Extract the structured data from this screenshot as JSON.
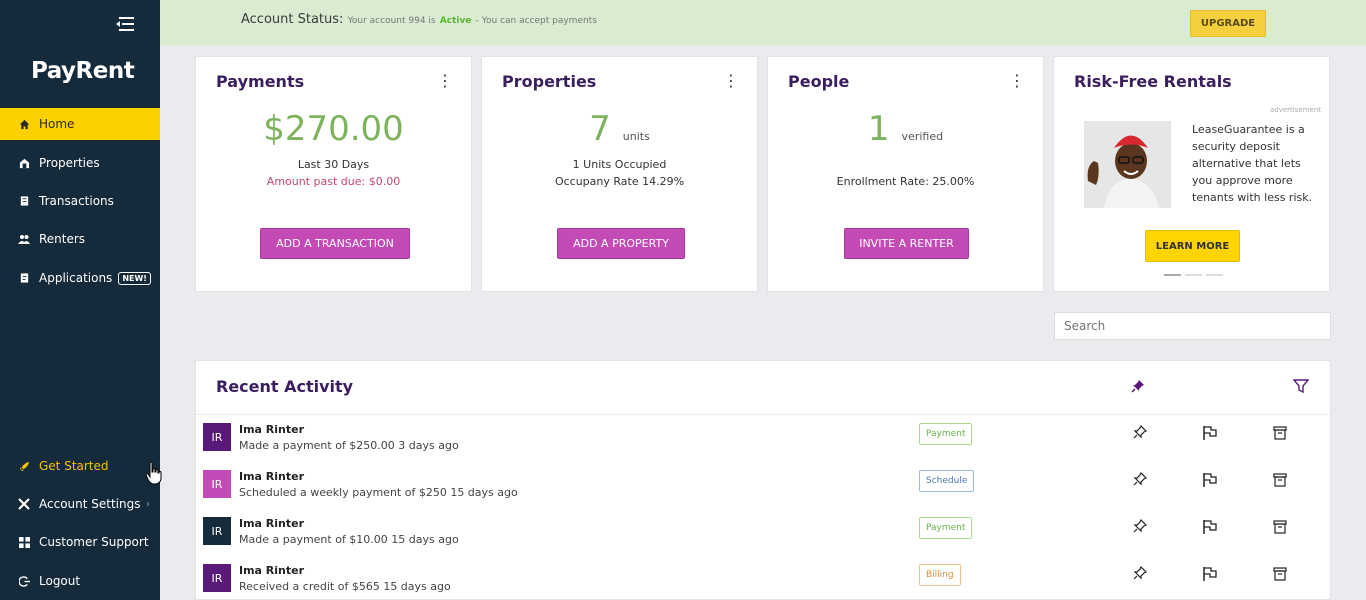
{
  "sidebar": {
    "logo": "PayRent",
    "items": [
      {
        "label": "Home",
        "icon": "home-icon",
        "active": true
      },
      {
        "label": "Properties",
        "icon": "properties-icon"
      },
      {
        "label": "Transactions",
        "icon": "transactions-icon"
      },
      {
        "label": "Renters",
        "icon": "renters-icon"
      },
      {
        "label": "Applications",
        "icon": "applications-icon",
        "badge": "NEW!"
      }
    ],
    "bottom_items": [
      {
        "label": "Get Started",
        "icon": "rocket-icon"
      },
      {
        "label": "Account Settings",
        "icon": "tools-icon"
      },
      {
        "label": "Customer Support",
        "icon": "support-icon"
      },
      {
        "label": "Logout",
        "icon": "logout-icon"
      }
    ]
  },
  "status_bar": {
    "title": "Account Status:",
    "text_prefix": "Your account 994 is",
    "status": "Active",
    "text_suffix": "- You can accept payments",
    "upgrade_label": "UPGRADE"
  },
  "cards": {
    "payments": {
      "title": "Payments",
      "amount": "$270.00",
      "period": "Last 30 Days",
      "past_due": "Amount past due: $0.00",
      "button": "ADD A TRANSACTION"
    },
    "properties": {
      "title": "Properties",
      "count": "7",
      "unit": "units",
      "occupied": "1 Units Occupied",
      "occupancy": "Occupany Rate 14.29%",
      "button": "ADD A PROPERTY"
    },
    "people": {
      "title": "People",
      "count": "1",
      "unit": "verified",
      "enrollment": "Enrollment Rate: 25.00%",
      "button": "INVITE A RENTER"
    },
    "ad": {
      "title": "Risk-Free Rentals",
      "label": "advertisement",
      "text": "LeaseGuarantee is a security deposit alternative that lets you approve more tenants with less risk.",
      "button": "LEARN MORE"
    }
  },
  "search": {
    "placeholder": "Search"
  },
  "activity": {
    "title": "Recent Activity",
    "rows": [
      {
        "initials": "IR",
        "name": "Ima Rinter",
        "desc": "Made a payment of $250.00 3 days ago",
        "tag": "Payment",
        "avatar_color": "#5a1a7a"
      },
      {
        "initials": "IR",
        "name": "Ima Rinter",
        "desc": "Scheduled a weekly payment of $250 15 days ago",
        "tag": "Schedule",
        "avatar_color": "#c44bb6"
      },
      {
        "initials": "IR",
        "name": "Ima Rinter",
        "desc": "Made a payment of $10.00 15 days ago",
        "tag": "Payment",
        "avatar_color": "#152a3a"
      },
      {
        "initials": "IR",
        "name": "Ima Rinter",
        "desc": "Received a credit of $565 15 days ago",
        "tag": "Billing",
        "avatar_color": "#5a1a7a"
      }
    ]
  }
}
